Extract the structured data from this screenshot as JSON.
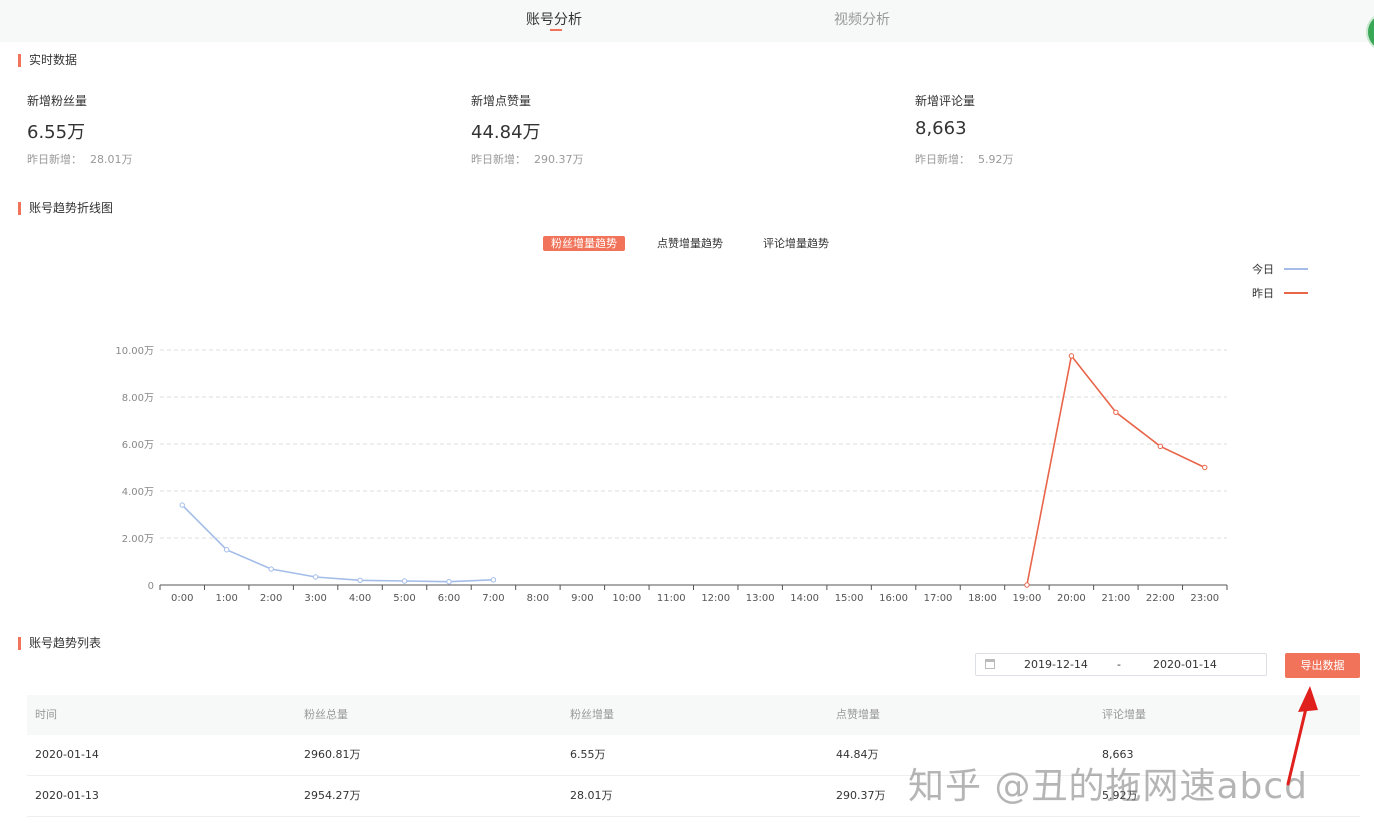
{
  "tabs": [
    {
      "label": "账号分析",
      "active": true
    },
    {
      "label": "视频分析",
      "active": false
    }
  ],
  "realtime": {
    "title": "实时数据",
    "stats": [
      {
        "label": "新增粉丝量",
        "value": "6.55万",
        "sub_label": "昨日新增：",
        "sub_value": "28.01万"
      },
      {
        "label": "新增点赞量",
        "value": "44.84万",
        "sub_label": "昨日新增：",
        "sub_value": "290.37万"
      },
      {
        "label": "新增评论量",
        "value": "8,663",
        "sub_label": "昨日新增：",
        "sub_value": "5.92万"
      }
    ]
  },
  "trend": {
    "title": "账号趋势折线图",
    "tabs": [
      {
        "label": "粉丝增量趋势",
        "active": true
      },
      {
        "label": "点赞增量趋势",
        "active": false
      },
      {
        "label": "评论增量趋势",
        "active": false
      }
    ]
  },
  "chart_data": {
    "type": "line",
    "x": [
      "0:00",
      "1:00",
      "2:00",
      "3:00",
      "4:00",
      "5:00",
      "6:00",
      "7:00",
      "8:00",
      "9:00",
      "10:00",
      "11:00",
      "12:00",
      "13:00",
      "14:00",
      "15:00",
      "16:00",
      "17:00",
      "18:00",
      "19:00",
      "20:00",
      "21:00",
      "22:00",
      "23:00"
    ],
    "ylim": [
      0,
      100000
    ],
    "yticks": [
      {
        "value": 0,
        "label": "0"
      },
      {
        "value": 20000,
        "label": "2.00万"
      },
      {
        "value": 40000,
        "label": "4.00万"
      },
      {
        "value": 60000,
        "label": "6.00万"
      },
      {
        "value": 80000,
        "label": "8.00万"
      },
      {
        "value": 100000,
        "label": "10.00万"
      }
    ],
    "grid": true,
    "legend_position": "top-right",
    "series": [
      {
        "name": "今日",
        "color": "#a3bde8",
        "values": [
          34000,
          15000,
          6800,
          3400,
          2000,
          1700,
          1400,
          2200
        ]
      },
      {
        "name": "昨日",
        "color": "#e8654a",
        "start_index": 19,
        "values": [
          0,
          97500,
          73500,
          59000,
          50000
        ]
      }
    ]
  },
  "list": {
    "title": "账号趋势列表",
    "date_start": "2019-12-14",
    "date_sep": "-",
    "date_end": "2020-01-14",
    "export_label": "导出数据",
    "columns": [
      "时间",
      "粉丝总量",
      "粉丝增量",
      "点赞增量",
      "评论增量"
    ],
    "rows": [
      [
        "2020-01-14",
        "2960.81万",
        "6.55万",
        "44.84万",
        "8,663"
      ],
      [
        "2020-01-13",
        "2954.27万",
        "28.01万",
        "290.37万",
        "5.92万"
      ]
    ]
  },
  "watermark": "知乎 @丑的拖网速abcd",
  "colors": {
    "accent": "#f0735a",
    "today_line": "#a3bde8",
    "yesterday_line": "#e8654a",
    "arrow": "#e0201c"
  }
}
